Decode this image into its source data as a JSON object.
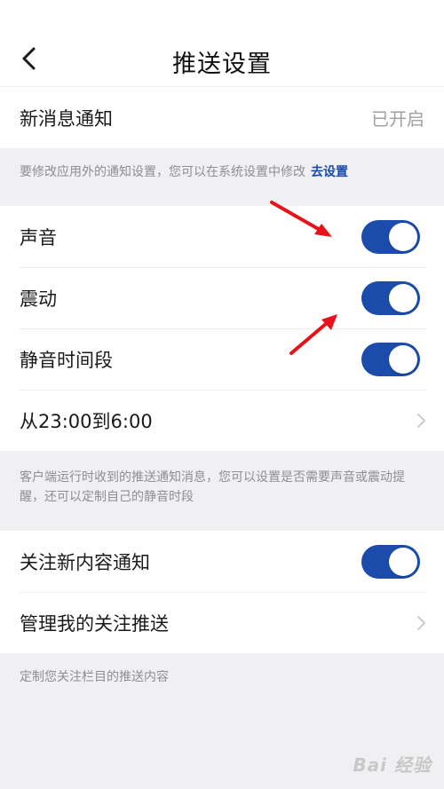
{
  "header": {
    "title": "推送设置",
    "back_icon": "chevron-left-icon"
  },
  "new_message": {
    "label": "新消息通知",
    "status": "已开启"
  },
  "system_hint": {
    "text": "要修改应用外的通知设置，您可以在系统设置中修改",
    "link": "去设置"
  },
  "settings": {
    "sound": {
      "label": "声音",
      "enabled": true
    },
    "vibration": {
      "label": "震动",
      "enabled": true
    },
    "mute_period": {
      "label": "静音时间段",
      "enabled": true
    },
    "mute_time": {
      "label": "从23:00到6:00"
    }
  },
  "mute_hint": "客户端运行时收到的推送通知消息，您可以设置是否需要声音或震动提醒，还可以定制自己的静音时段",
  "follow": {
    "new_content": {
      "label": "关注新内容通知",
      "enabled": true
    },
    "manage": {
      "label": "管理我的关注推送"
    }
  },
  "follow_hint": "定制您关注栏目的推送内容",
  "watermark": "Bai 经验",
  "colors": {
    "accent": "#1b4bab",
    "background": "#f0f0f2",
    "annotation_arrow": "#e8121b"
  }
}
